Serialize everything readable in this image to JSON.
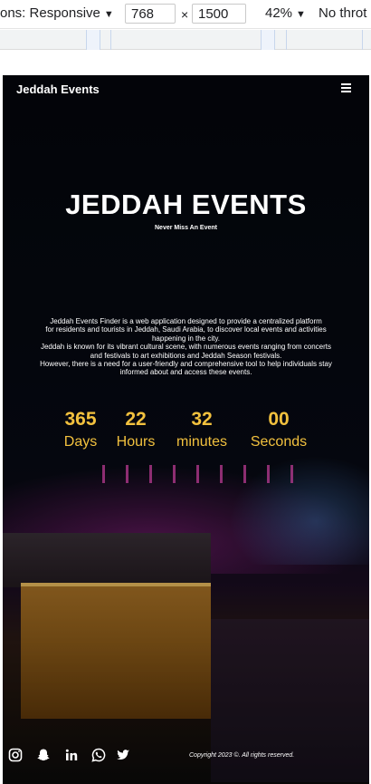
{
  "devtools": {
    "dimensions_label": "ons: Responsive",
    "width": "768",
    "times": "×",
    "height": "1500",
    "zoom": "42%",
    "throttle": "No throt"
  },
  "site": {
    "brand": "Jeddah Events",
    "menu_icon": "hamburger-menu-icon",
    "hero_title": "JEDDAH EVENTS",
    "hero_subtitle": "Never Miss An Event",
    "description": [
      "Jeddah Events Finder is a web application designed to provide a centralized platform",
      "for residents and tourists in Jeddah, Saudi Arabia, to discover local events and activities",
      "happening in the city.",
      "Jeddah is known for its vibrant cultural scene, with numerous events ranging from concerts",
      "and festivals to art exhibitions and Jeddah Season festivals.",
      "However, there is a need for a user-friendly and comprehensive tool to help individuals stay",
      "informed about and access these events."
    ],
    "countdown": [
      {
        "value": "365",
        "label": "Days"
      },
      {
        "value": "22",
        "label": "Hours"
      },
      {
        "value": "32",
        "label": "minutes"
      },
      {
        "value": "00",
        "label": "Seconds"
      }
    ],
    "accent_color": "#f2c13e",
    "footer": {
      "social_icons": [
        "instagram-icon",
        "snapchat-icon",
        "linkedin-icon",
        "whatsapp-icon",
        "twitter-icon"
      ],
      "copyright": "Copyright 2023 ©. All rights reserved."
    }
  }
}
